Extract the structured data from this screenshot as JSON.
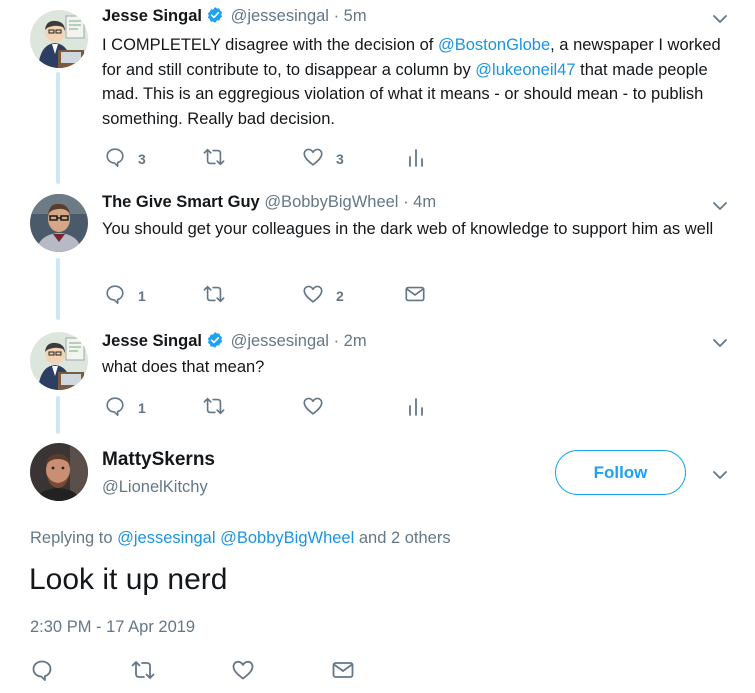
{
  "tweets": [
    {
      "name": "Jesse Singal",
      "handle": "@jessesingal",
      "time": "5m",
      "text_parts": [
        "I COMPLETELY disagree with the decision of ",
        "@BostonGlobe",
        ", a newspaper I worked for and still contribute to, to disappear a column by ",
        "@lukeoneil47",
        " that made people mad. This is an eggregious violation of what it means - or should mean - to publish something. Really bad decision."
      ],
      "replies": "3",
      "retweets": "",
      "likes": "3"
    },
    {
      "name": "The Give Smart Guy",
      "handle": "@BobbyBigWheel",
      "time": "4m",
      "text": "You should get your colleagues in the dark web of knowledge to support him as well",
      "replies": "1",
      "retweets": "",
      "likes": "2"
    },
    {
      "name": "Jesse Singal",
      "handle": "@jessesingal",
      "time": "2m",
      "text": "what does that mean?",
      "replies": "1",
      "retweets": "",
      "likes": ""
    }
  ],
  "main": {
    "name": "MattySkerns",
    "handle": "@LionelKitchy",
    "follow_label": "Follow",
    "replying_prefix": "Replying to ",
    "replying_to_1": "@jessesingal",
    "replying_to_2": "@BobbyBigWheel",
    "replying_suffix": " and 2 others",
    "text": "Look it up nerd",
    "timestamp": "2:30 PM - 17 Apr 2019"
  },
  "separator": "·",
  "colors": {
    "accent": "#1da1f2",
    "link": "#1b95e0",
    "muted": "#657786",
    "thread_line": "#cfe6f7",
    "text": "#14171a"
  },
  "icons": [
    "reply-icon",
    "retweet-icon",
    "like-icon",
    "analytics-icon",
    "direct-message-icon",
    "verified-badge-icon",
    "chevron-down-icon"
  ]
}
